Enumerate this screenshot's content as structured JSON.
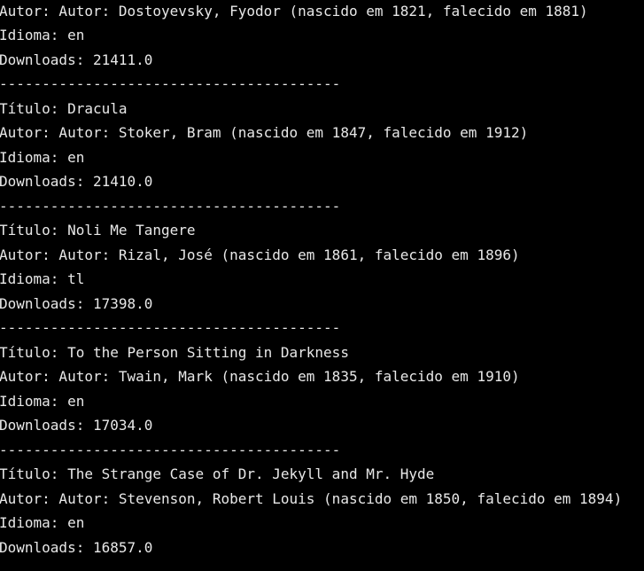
{
  "console": {
    "background": "#000000",
    "text_color": "#e8e8e8",
    "lines": [
      "Autor: Autor: Dostoyevsky, Fyodor (nascido em 1821, falecido em 1881)",
      "Idioma: en",
      "Downloads: 21411.0",
      "----------------------------------------",
      "Título: Dracula",
      "Autor: Autor: Stoker, Bram (nascido em 1847, falecido em 1912)",
      "Idioma: en",
      "Downloads: 21410.0",
      "----------------------------------------",
      "Título: Noli Me Tangere",
      "Autor: Autor: Rizal, José (nascido em 1861, falecido em 1896)",
      "Idioma: tl",
      "Downloads: 17398.0",
      "----------------------------------------",
      "Título: To the Person Sitting in Darkness",
      "Autor: Autor: Twain, Mark (nascido em 1835, falecido em 1910)",
      "Idioma: en",
      "Downloads: 17034.0",
      "----------------------------------------",
      "Título: The Strange Case of Dr. Jekyll and Mr. Hyde",
      "Autor: Autor: Stevenson, Robert Louis (nascido em 1850, falecido em 1894)",
      "Idioma: en",
      "Downloads: 16857.0",
      "----------------------------------------"
    ]
  }
}
